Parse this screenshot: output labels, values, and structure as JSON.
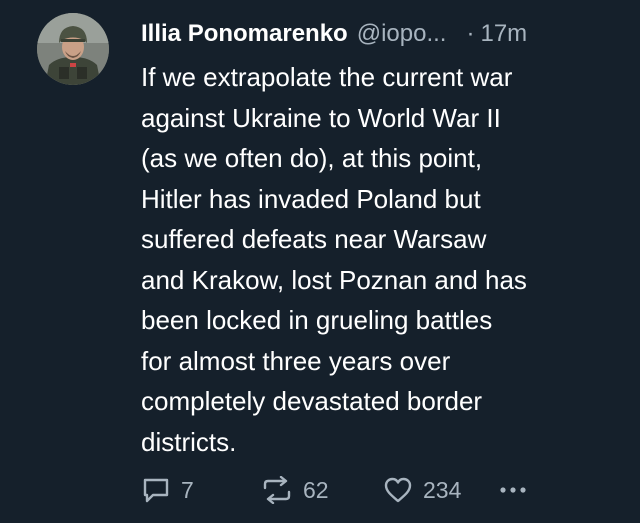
{
  "tweet": {
    "author": {
      "display_name": "Illia Ponomarenko",
      "handle": "@iopo...",
      "separator": "·",
      "time": "17m"
    },
    "lines": [
      "If we extrapolate the current war",
      "against Ukraine to World War II",
      "(as we often do), at this point,",
      "Hitler has invaded Poland but",
      "suffered defeats near Warsaw",
      "and Krakow, lost Poznan and has",
      "been locked in grueling battles",
      "for almost three years over",
      "completely devastated border",
      "districts."
    ],
    "actions": {
      "reply_count": "7",
      "retweet_count": "62",
      "like_count": "234",
      "reply_icon": "reply-icon",
      "retweet_icon": "retweet-icon",
      "like_icon": "heart-icon",
      "more_icon": "more-icon"
    }
  },
  "colors": {
    "background": "#15202b",
    "text": "#ffffff",
    "secondary": "#a8b4bf"
  }
}
